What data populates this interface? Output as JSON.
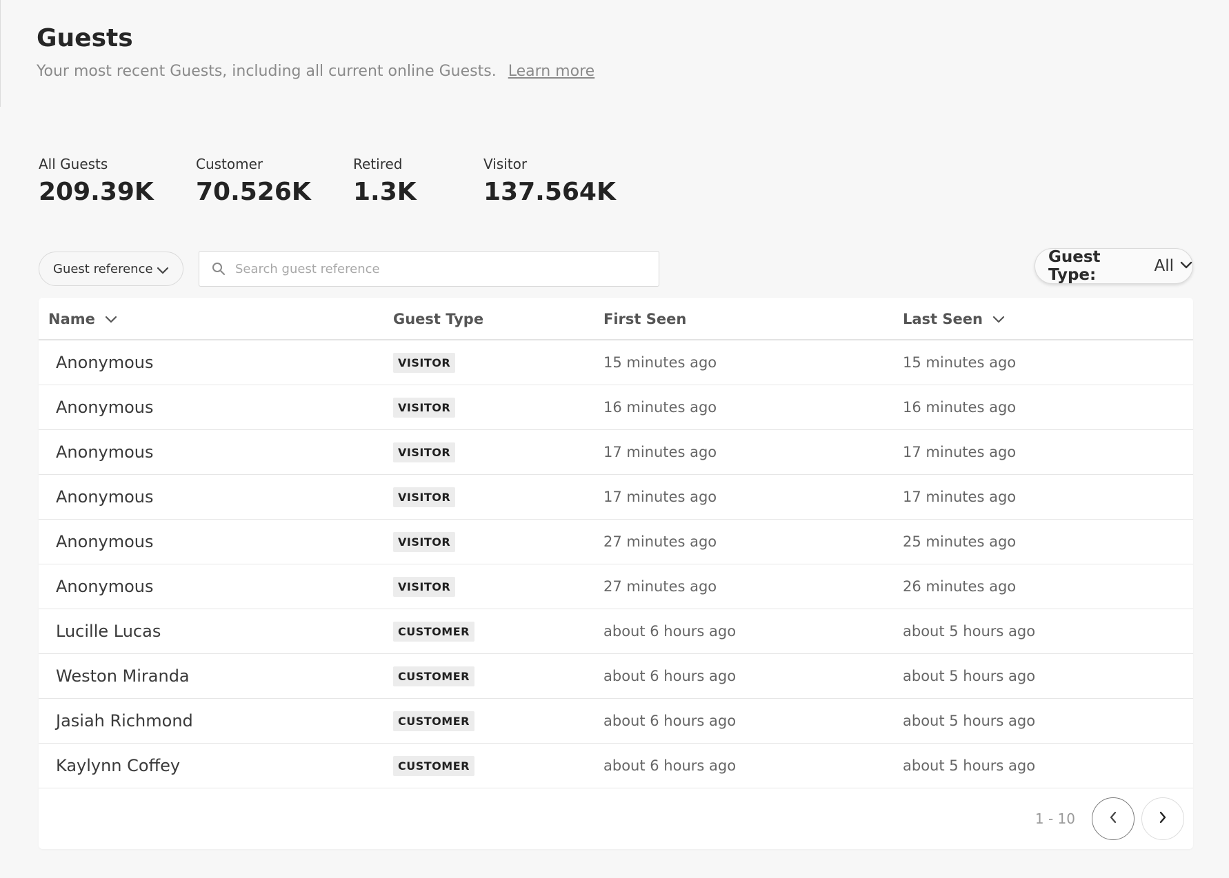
{
  "header": {
    "title": "Guests",
    "subtitle": "Your most recent Guests, including all current online Guests.",
    "learn_more": "Learn more"
  },
  "stats": [
    {
      "label": "All Guests",
      "value": "209.39K"
    },
    {
      "label": "Customer",
      "value": "70.526K"
    },
    {
      "label": "Retired",
      "value": "1.3K"
    },
    {
      "label": "Visitor",
      "value": "137.564K"
    }
  ],
  "filters": {
    "reference_select": "Guest reference",
    "search_placeholder": "Search guest reference",
    "guest_type_label": "Guest Type:",
    "guest_type_value": "All"
  },
  "table": {
    "columns": {
      "name": "Name",
      "guest_type": "Guest Type",
      "first_seen": "First Seen",
      "last_seen": "Last Seen"
    },
    "rows": [
      {
        "name": "Anonymous",
        "type": "VISITOR",
        "first_seen": "15 minutes ago",
        "last_seen": "15 minutes ago"
      },
      {
        "name": "Anonymous",
        "type": "VISITOR",
        "first_seen": "16 minutes ago",
        "last_seen": "16 minutes ago"
      },
      {
        "name": "Anonymous",
        "type": "VISITOR",
        "first_seen": "17 minutes ago",
        "last_seen": "17 minutes ago"
      },
      {
        "name": "Anonymous",
        "type": "VISITOR",
        "first_seen": "17 minutes ago",
        "last_seen": "17 minutes ago"
      },
      {
        "name": "Anonymous",
        "type": "VISITOR",
        "first_seen": "27 minutes ago",
        "last_seen": "25 minutes ago"
      },
      {
        "name": "Anonymous",
        "type": "VISITOR",
        "first_seen": "27 minutes ago",
        "last_seen": "26 minutes ago"
      },
      {
        "name": "Lucille Lucas",
        "type": "CUSTOMER",
        "first_seen": "about 6 hours ago",
        "last_seen": "about 5 hours ago"
      },
      {
        "name": "Weston Miranda",
        "type": "CUSTOMER",
        "first_seen": "about 6 hours ago",
        "last_seen": "about 5 hours ago"
      },
      {
        "name": "Jasiah Richmond",
        "type": "CUSTOMER",
        "first_seen": "about 6 hours ago",
        "last_seen": "about 5 hours ago"
      },
      {
        "name": "Kaylynn Coffey",
        "type": "CUSTOMER",
        "first_seen": "about 6 hours ago",
        "last_seen": "about 5 hours ago"
      }
    ]
  },
  "pagination": {
    "range": "1 - 10"
  },
  "icons": {
    "search": "search-icon",
    "dropdown": "chevron-down-icon",
    "prev": "chevron-left-icon",
    "next": "chevron-right-icon"
  },
  "colors": {
    "background": "#f7f7f7",
    "card": "#ffffff",
    "badge": "#ececec"
  }
}
